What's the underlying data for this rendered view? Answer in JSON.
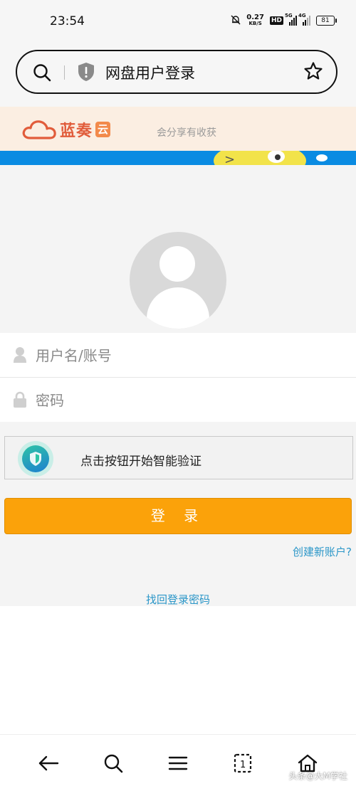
{
  "status_bar": {
    "time": "23:54",
    "net_speed_value": "0.27",
    "net_speed_unit": "KB/S",
    "hd_badge": "HD",
    "signal_1_label": "5G",
    "signal_2_label": "4G",
    "battery": "81"
  },
  "address_bar": {
    "title": "网盘用户登录"
  },
  "banner": {
    "logo_text": "蓝奏",
    "logo_badge": "云",
    "tagline": "会分享有收获"
  },
  "login_form": {
    "username_placeholder": "用户名/账号",
    "password_placeholder": "密码",
    "captcha_label": "点击按钮开始智能验证",
    "login_button": "登 录",
    "create_account_link": "创建新账户?",
    "forgot_password_link": "找回登录密码"
  },
  "watermark": "头条@大M学社",
  "colors": {
    "login_button": "#fba20a",
    "link": "#2a96c8",
    "logo": "#e15c3b",
    "banner_bg": "#fbeee2"
  }
}
